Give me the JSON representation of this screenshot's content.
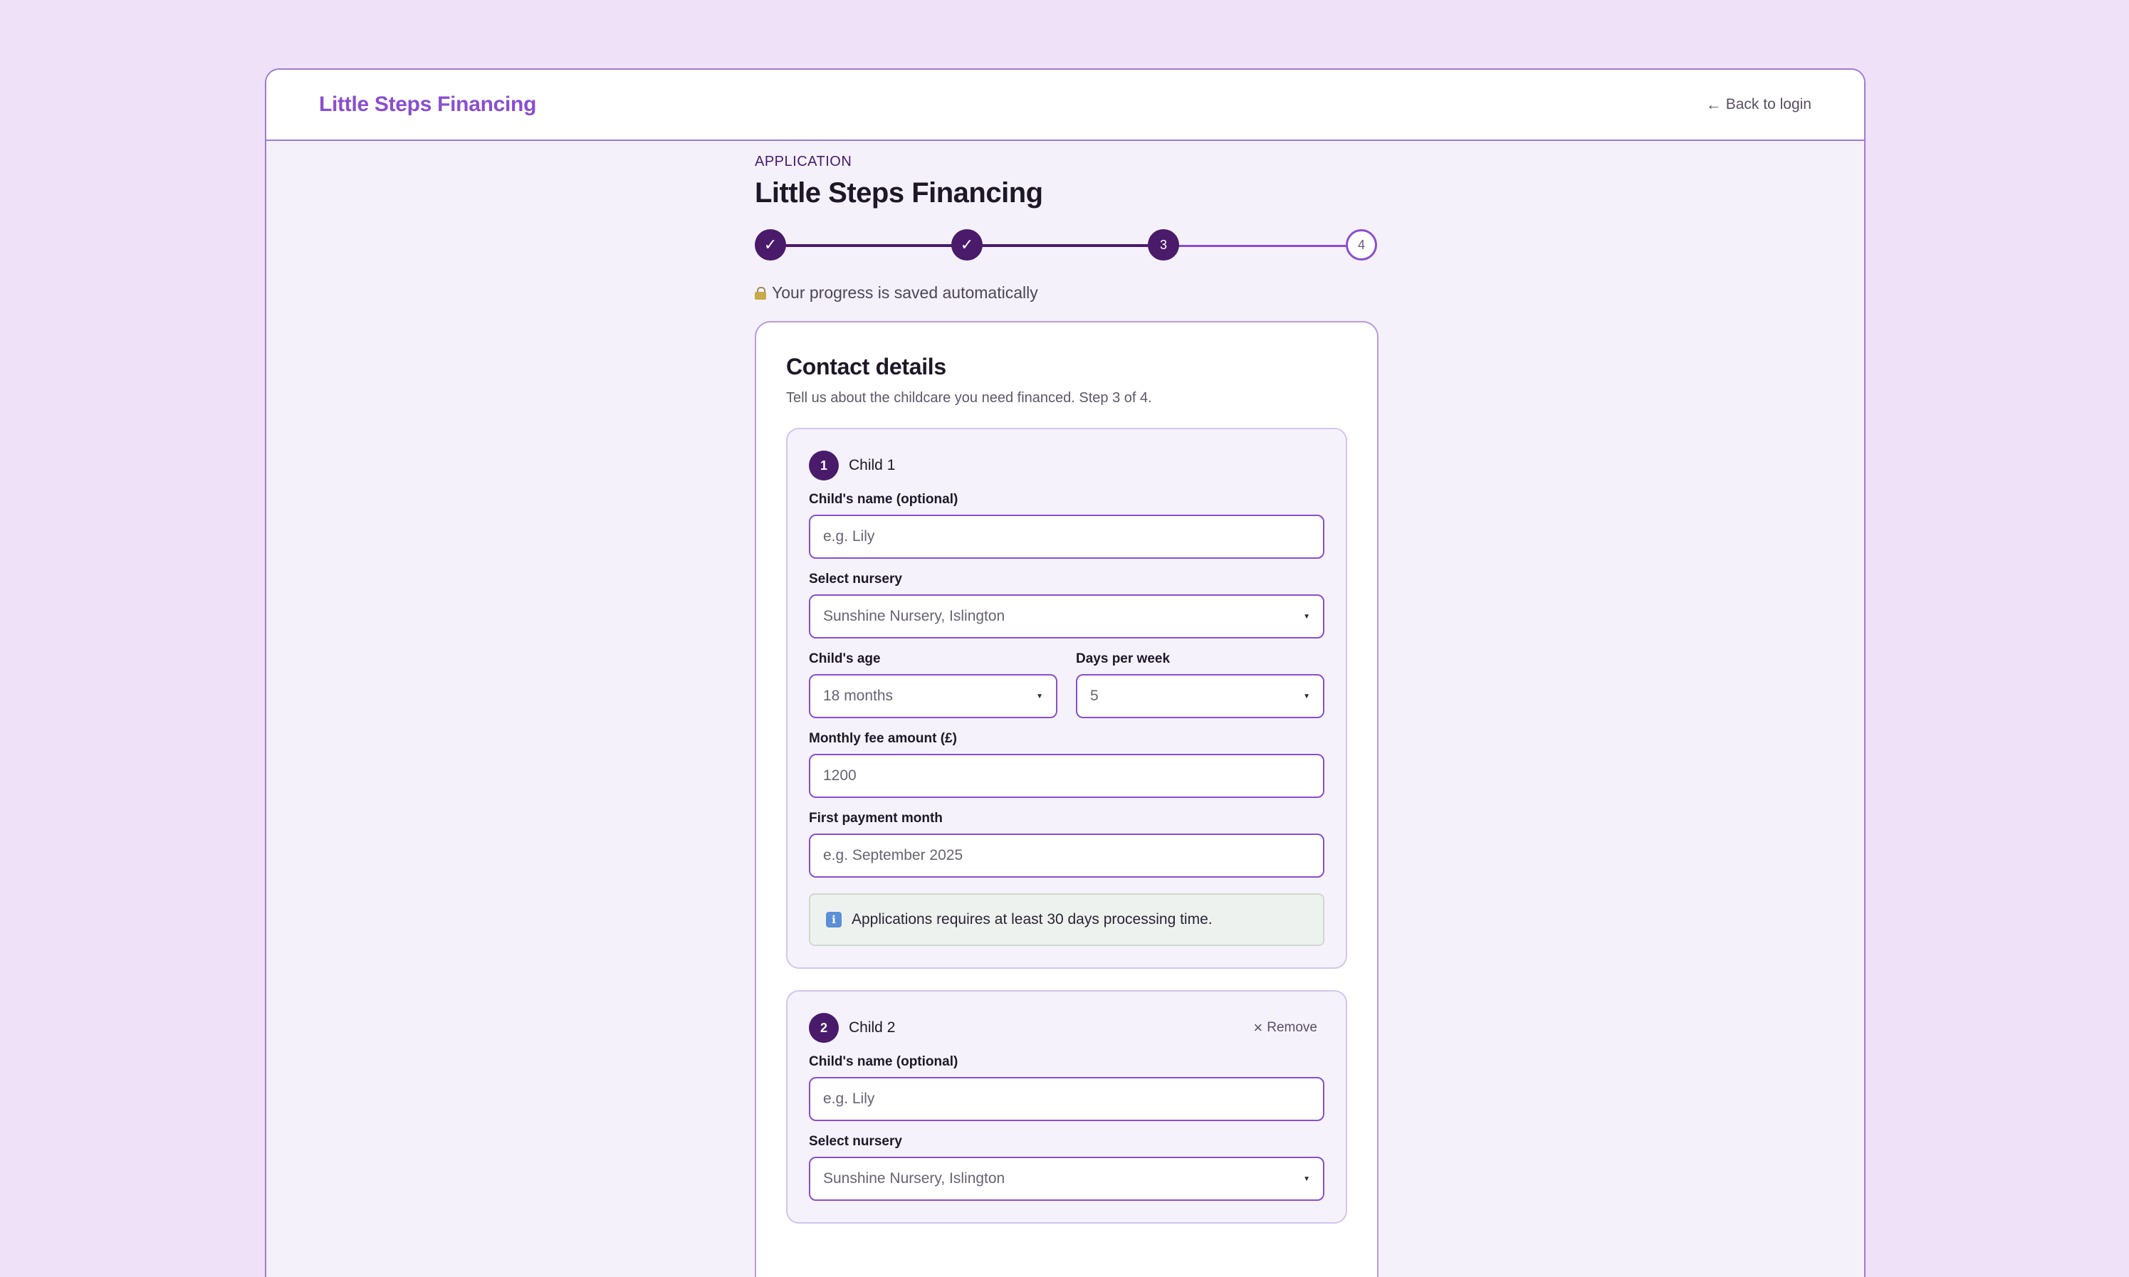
{
  "header": {
    "brand": "Little Steps Financing",
    "back_link": "Back to login",
    "back_icon": "arrow-left-icon"
  },
  "page": {
    "eyebrow": "APPLICATION",
    "title": "Little Steps Financing",
    "saved_note": "Your progress is saved automatically"
  },
  "stepper": {
    "current_step": 3,
    "total_steps": 4,
    "steps": [
      {
        "label": "✓",
        "state": "complete"
      },
      {
        "label": "✓",
        "state": "complete"
      },
      {
        "label": "3",
        "state": "current"
      },
      {
        "label": "4",
        "state": "upcoming"
      }
    ]
  },
  "card": {
    "title": "Contact details",
    "subtitle": "Tell us about the childcare you need financed. Step 3 of 4."
  },
  "children": [
    {
      "number": "1",
      "label": "Child 1",
      "name_label": "Child's name (optional)",
      "name_placeholder": "e.g. Lily",
      "nursery_label": "Select nursery",
      "nursery_value": "Sunshine Nursery, Islington",
      "age_label": "Child's age",
      "age_value": "18 months",
      "days_label": "Days per week",
      "days_value": "5",
      "fee_label": "Monthly fee amount (£)",
      "fee_value": "1200",
      "payment_label": "First payment month",
      "payment_placeholder": "e.g. September 2025",
      "info_text": "Applications requires at least 30 days processing time."
    },
    {
      "number": "2",
      "label": "Child 2",
      "remove_label": "Remove",
      "name_label": "Child's name (optional)",
      "name_placeholder": "e.g. Lily",
      "nursery_label": "Select nursery",
      "nursery_value": "Sunshine Nursery, Islington"
    }
  ],
  "colors": {
    "background": "#efe1f7",
    "accent": "#8a4ed0",
    "primary_dark": "#4a1a6b"
  }
}
